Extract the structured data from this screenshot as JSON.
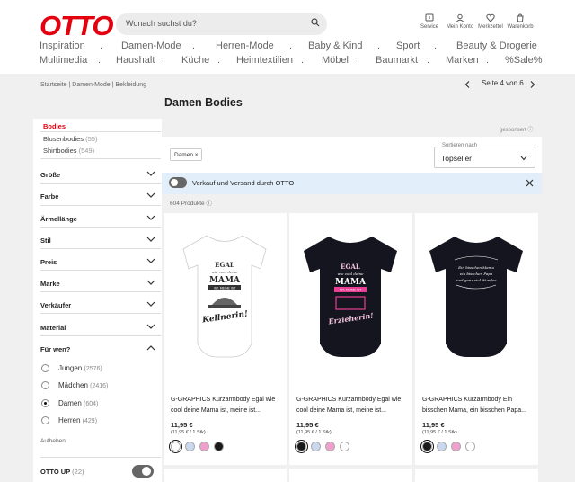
{
  "header": {
    "logo": "OTTO",
    "search_placeholder": "Wonach suchst du?",
    "icons": [
      {
        "name": "service-icon",
        "label": "Service"
      },
      {
        "name": "account-icon",
        "label": "Mein Konto"
      },
      {
        "name": "wishlist-icon",
        "label": "Merkzettel"
      },
      {
        "name": "cart-icon",
        "label": "Warenkorb"
      }
    ]
  },
  "nav": {
    "row1": [
      "Inspiration",
      "Damen-Mode",
      "Herren-Mode",
      "Baby & Kind",
      "Sport",
      "Beauty & Drogerie"
    ],
    "row2": [
      "Multimedia",
      "Haushalt",
      "Küche",
      "Heimtextilien",
      "Möbel",
      "Baumarkt",
      "Marken",
      "%Sale%"
    ],
    "separator": "."
  },
  "breadcrumb": "Startseite | Damen-Mode | Bekleidung",
  "pagination": {
    "label": "Seite 4 von 6"
  },
  "page_title": "Damen Bodies",
  "sidebar": {
    "categories": [
      {
        "label": "Bodies",
        "count": ""
      },
      {
        "label": "Blusenbodies",
        "count": "(55)"
      },
      {
        "label": "Shirtbodies",
        "count": "(549)"
      }
    ],
    "filters": [
      "Größe",
      "Farbe",
      "Ärmellänge",
      "Stil",
      "Preis",
      "Marke",
      "Verkäufer",
      "Material",
      "Für wen?"
    ],
    "for_whom": [
      {
        "label": "Jungen",
        "count": "(2576)",
        "selected": false
      },
      {
        "label": "Mädchen",
        "count": "(2416)",
        "selected": false
      },
      {
        "label": "Damen",
        "count": "(604)",
        "selected": true
      },
      {
        "label": "Herren",
        "count": "(429)",
        "selected": false
      }
    ],
    "reset": "Aufheben",
    "otto_up": {
      "label": "OTTO UP",
      "count": "(22)"
    }
  },
  "sponsored": "gesponsert ⓘ",
  "active_chip": "Damen ×",
  "sort": {
    "label": "Sortieren nach",
    "value": "Topseller"
  },
  "banner": {
    "text": "Verkauf und Versand durch OTTO"
  },
  "product_count": "604 Produkte ⓘ",
  "products": [
    {
      "title_line1": "G-GRAPHICS Kurzarmbody Egal wie",
      "title_line2": "cool deine Mama ist, meine ist...",
      "price": "11,95 €",
      "unit": "(11,95 € / 1 Stk)",
      "body_color": "#ffffff",
      "print": [
        "EGAL",
        "wie cool deine",
        "MAMA",
        "IST, MEINE IST",
        "Kellnerin!"
      ]
    },
    {
      "title_line1": "G-GRAPHICS Kurzarmbody Egal wie",
      "title_line2": "cool deine Mama ist, meine ist...",
      "price": "11,95 €",
      "unit": "(11,95 € / 1 Stk)",
      "body_color": "#15151f",
      "print": [
        "EGAL",
        "wie cool deine",
        "MAMA",
        "IST, MEINE IST",
        "Erzieherin!"
      ]
    },
    {
      "title_line1": "G-GRAPHICS Kurzarmbody Ein",
      "title_line2": "bisschen Mama, ein bisschen Papa...",
      "price": "11,95 €",
      "unit": "(11,95 € / 1 Stk)",
      "body_color": "#15151f",
      "print": [
        "Ein bisschen Mama",
        "ein bisschen Papa",
        "und ganz viel Wunder"
      ]
    }
  ],
  "swatch_colors": [
    "#ffffff",
    "#c9d8ee",
    "#f0a0cc",
    "#1a1a1a"
  ],
  "colors": {
    "brand": "#e3000f",
    "banner_bg": "#e2eef9"
  }
}
